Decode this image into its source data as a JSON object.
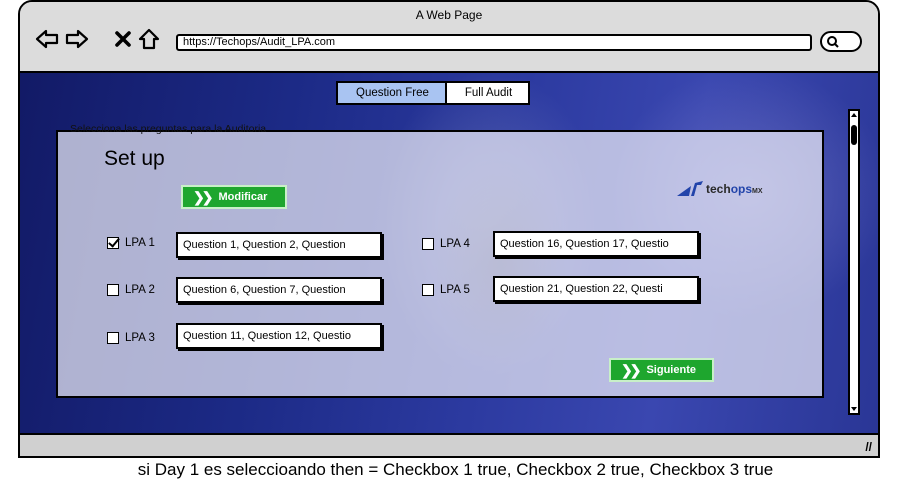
{
  "window": {
    "title": "A Web Page"
  },
  "nav": {
    "back_icon": "back-arrow-icon",
    "forward_icon": "forward-arrow-icon",
    "close_icon": "close-icon",
    "home_icon": "home-icon",
    "url": "https://Techops/Audit_LPA.com",
    "search_icon": "search-icon"
  },
  "tabs": [
    {
      "label": "Question Free",
      "active": true
    },
    {
      "label": "Full Audit",
      "active": false
    }
  ],
  "panel": {
    "legend": "Selecciona las preguntas para la Auditoria",
    "heading": "Set up",
    "modificar_label": "Modificar",
    "siguiente_label": "Siguiente",
    "logo": {
      "brand": "tech",
      "brand_accent": "ops",
      "suffix": "MX"
    }
  },
  "lpas": [
    {
      "label": "LPA 1",
      "checked": true,
      "questions": "Question 1, Question 2, Question"
    },
    {
      "label": "LPA 2",
      "checked": false,
      "questions": "Question 6, Question 7, Question"
    },
    {
      "label": "LPA 3",
      "checked": false,
      "questions": "Question 11, Question 12, Questio"
    },
    {
      "label": "LPA 4",
      "checked": false,
      "questions": "Question 16, Question 17, Questio"
    },
    {
      "label": "LPA 5",
      "checked": false,
      "questions": "Question 21, Question 22, Questi"
    }
  ],
  "colors": {
    "accent_green": "#1ea62e",
    "tab_active": "#a9c4f2",
    "background_blue": "#1c2a86"
  },
  "note": "si Day 1 es seleccioando then = Checkbox 1 true, Checkbox 2 true, Checkbox 3 true"
}
